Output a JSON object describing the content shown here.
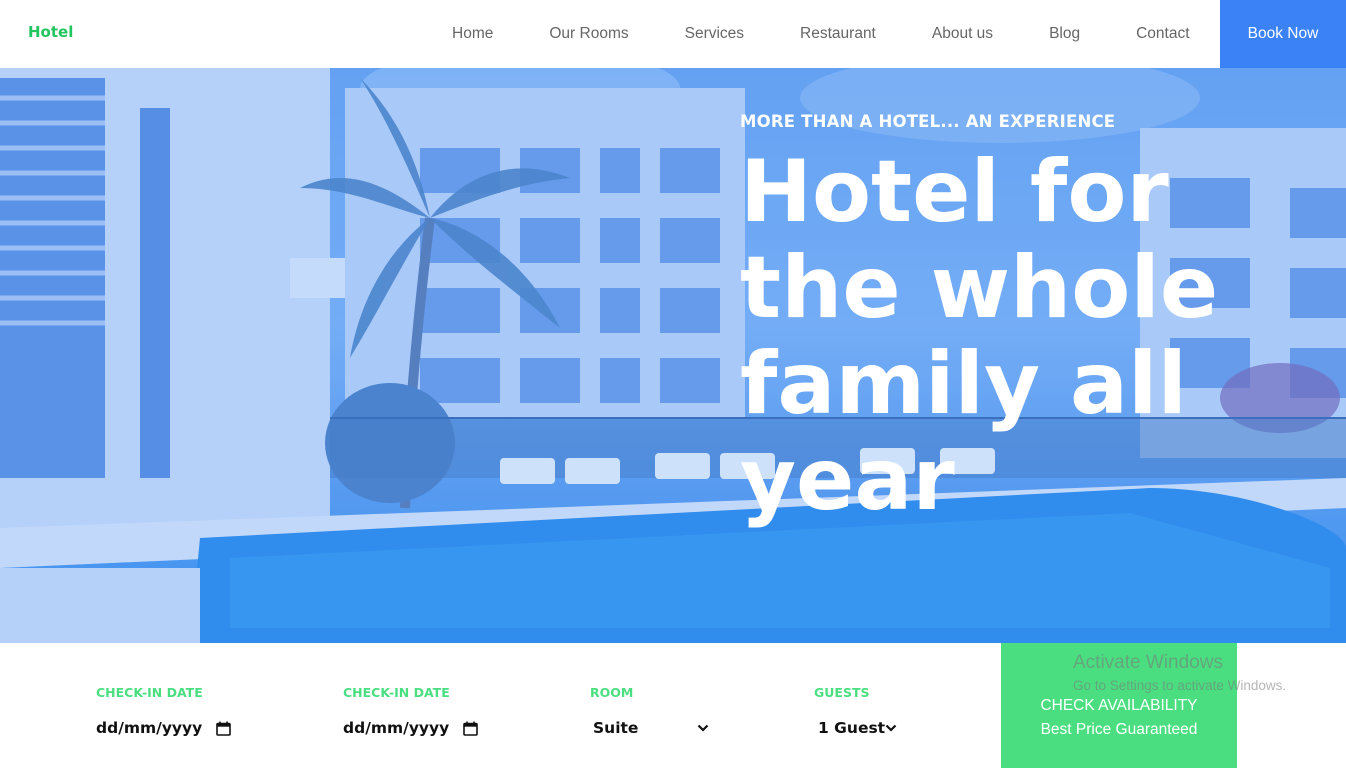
{
  "header": {
    "logo": "Hotel",
    "nav": [
      "Home",
      "Our Rooms",
      "Services",
      "Restaurant",
      "About us",
      "Blog",
      "Contact"
    ],
    "cta": "Book Now"
  },
  "hero": {
    "eyebrow": "MORE THAN A HOTEL... AN EXPERIENCE",
    "headline": "Hotel for the whole family all year"
  },
  "booking": {
    "checkin": {
      "label": "CHECK-IN DATE",
      "placeholder": "dd/mm/yyyy"
    },
    "checkout": {
      "label": "CHECK-IN DATE",
      "placeholder": "dd/mm/yyyy"
    },
    "room": {
      "label": "ROOM",
      "value": "Suite"
    },
    "guests": {
      "label": "GUESTS",
      "value": "1 Guest"
    },
    "submit": {
      "line1": "CHECK AVAILABILITY",
      "line2": "Best Price Guaranteed"
    }
  },
  "watermark": {
    "title": "Activate Windows",
    "subtitle": "Go to Settings to activate Windows."
  },
  "colors": {
    "accent_green": "#4ade80",
    "logo_green": "#22c55e",
    "accent_blue": "#3b82f6"
  }
}
